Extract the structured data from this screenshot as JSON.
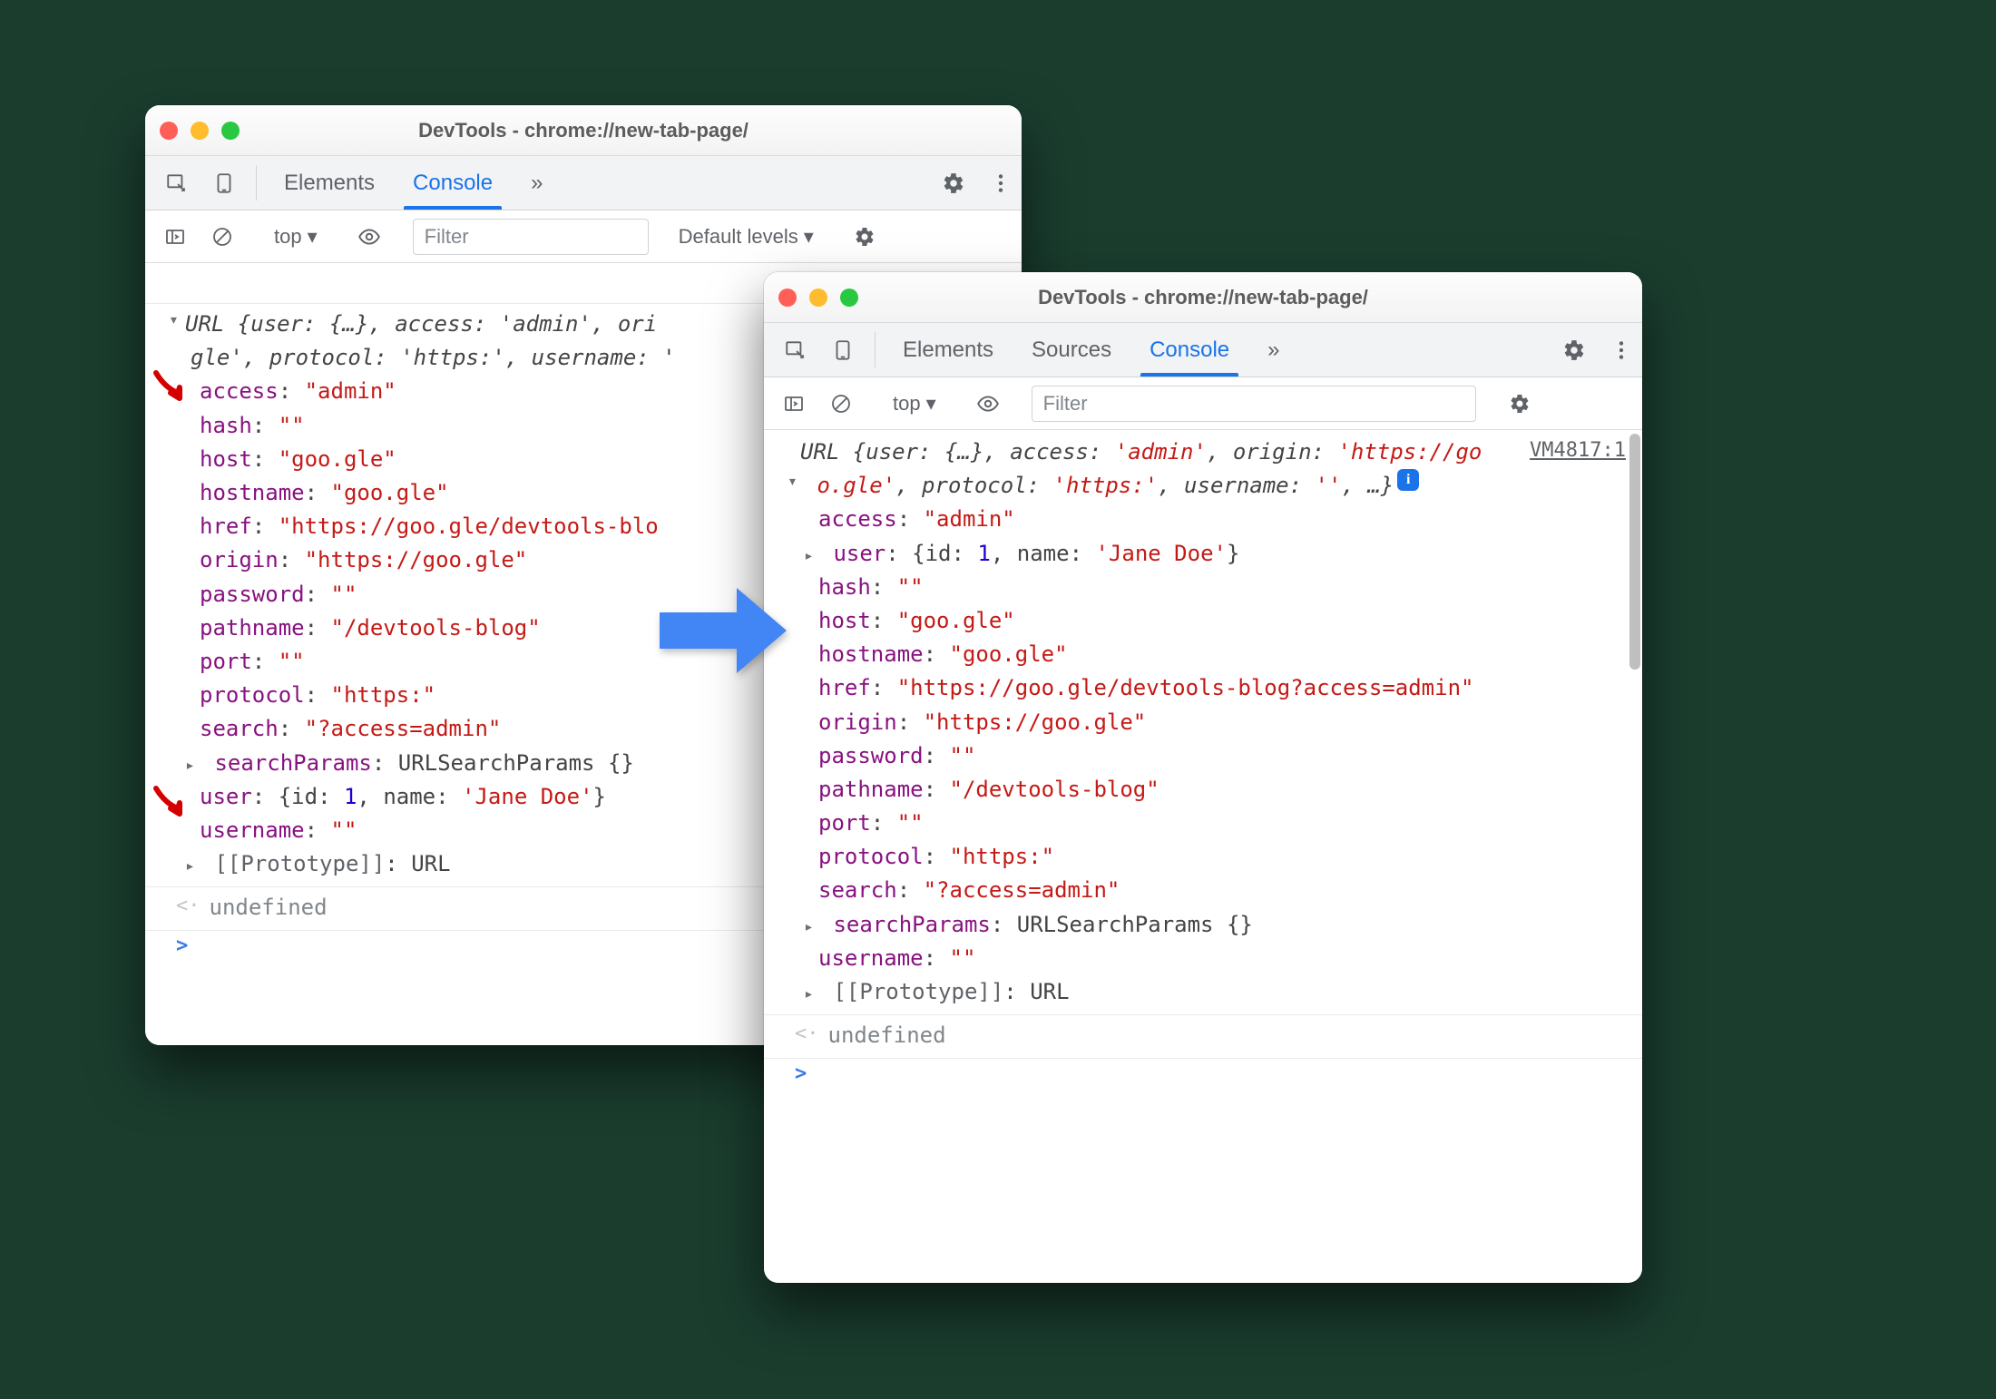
{
  "left": {
    "title": "DevTools - chrome://new-tab-page/",
    "tabs": {
      "elements": "Elements",
      "console": "Console",
      "more": "»"
    },
    "toolbar": {
      "context": "top",
      "filter_placeholder": "Filter",
      "levels": "Default levels"
    },
    "summary_line1": "URL {user: {…}, access: 'admin', ori",
    "summary_line2": "gle', protocol: 'https:', username: '",
    "props": {
      "access": {
        "key": "access",
        "val": "\"admin\""
      },
      "hash": {
        "key": "hash",
        "val": "\"\""
      },
      "host": {
        "key": "host",
        "val": "\"goo.gle\""
      },
      "hostname": {
        "key": "hostname",
        "val": "\"goo.gle\""
      },
      "href": {
        "key": "href",
        "val": "\"https://goo.gle/devtools-blo"
      },
      "origin": {
        "key": "origin",
        "val": "\"https://goo.gle\""
      },
      "password": {
        "key": "password",
        "val": "\"\""
      },
      "pathname": {
        "key": "pathname",
        "val": "\"/devtools-blog\""
      },
      "port": {
        "key": "port",
        "val": "\"\""
      },
      "protocol": {
        "key": "protocol",
        "val": "\"https:\""
      },
      "search": {
        "key": "search",
        "val": "\"?access=admin\""
      },
      "searchParams": {
        "key": "searchParams",
        "val": "URLSearchParams {}"
      },
      "user": {
        "key": "user",
        "open": "{",
        "id_k": "id",
        "id_v": "1",
        "name_k": "name",
        "name_v": "'Jane Doe'",
        "close": "}"
      },
      "username": {
        "key": "username",
        "val": "\"\""
      },
      "prototype": {
        "key": "[[Prototype]]",
        "val": "URL"
      }
    },
    "undefined": "undefined"
  },
  "right": {
    "title": "DevTools - chrome://new-tab-page/",
    "tabs": {
      "elements": "Elements",
      "sources": "Sources",
      "console": "Console",
      "more": "»"
    },
    "toolbar": {
      "context": "top",
      "filter_placeholder": "Filter"
    },
    "source_link": "VM4817:1",
    "summary_line1_a": "URL {user: {…}, access: ",
    "summary_line1_b": "'admin'",
    "summary_line1_c": ", origin: ",
    "summary_line1_d": "'https://go",
    "summary_line2_a": "o.gle'",
    "summary_line2_b": ", protocol: ",
    "summary_line2_c": "'https:'",
    "summary_line2_d": ", username: ",
    "summary_line2_e": "''",
    "summary_line2_f": ", …}",
    "props": {
      "access": {
        "key": "access",
        "val": "\"admin\""
      },
      "user": {
        "key": "user",
        "open": "{",
        "id_k": "id",
        "id_v": "1",
        "name_k": "name",
        "name_v": "'Jane Doe'",
        "close": "}"
      },
      "hash": {
        "key": "hash",
        "val": "\"\""
      },
      "host": {
        "key": "host",
        "val": "\"goo.gle\""
      },
      "hostname": {
        "key": "hostname",
        "val": "\"goo.gle\""
      },
      "href": {
        "key": "href",
        "val": "\"https://goo.gle/devtools-blog?access=admin\""
      },
      "origin": {
        "key": "origin",
        "val": "\"https://goo.gle\""
      },
      "password": {
        "key": "password",
        "val": "\"\""
      },
      "pathname": {
        "key": "pathname",
        "val": "\"/devtools-blog\""
      },
      "port": {
        "key": "port",
        "val": "\"\""
      },
      "protocol": {
        "key": "protocol",
        "val": "\"https:\""
      },
      "search": {
        "key": "search",
        "val": "\"?access=admin\""
      },
      "searchParams": {
        "key": "searchParams",
        "val": "URLSearchParams {}"
      },
      "username": {
        "key": "username",
        "val": "\"\""
      },
      "prototype": {
        "key": "[[Prototype]]",
        "val": "URL"
      }
    },
    "undefined": "undefined"
  }
}
